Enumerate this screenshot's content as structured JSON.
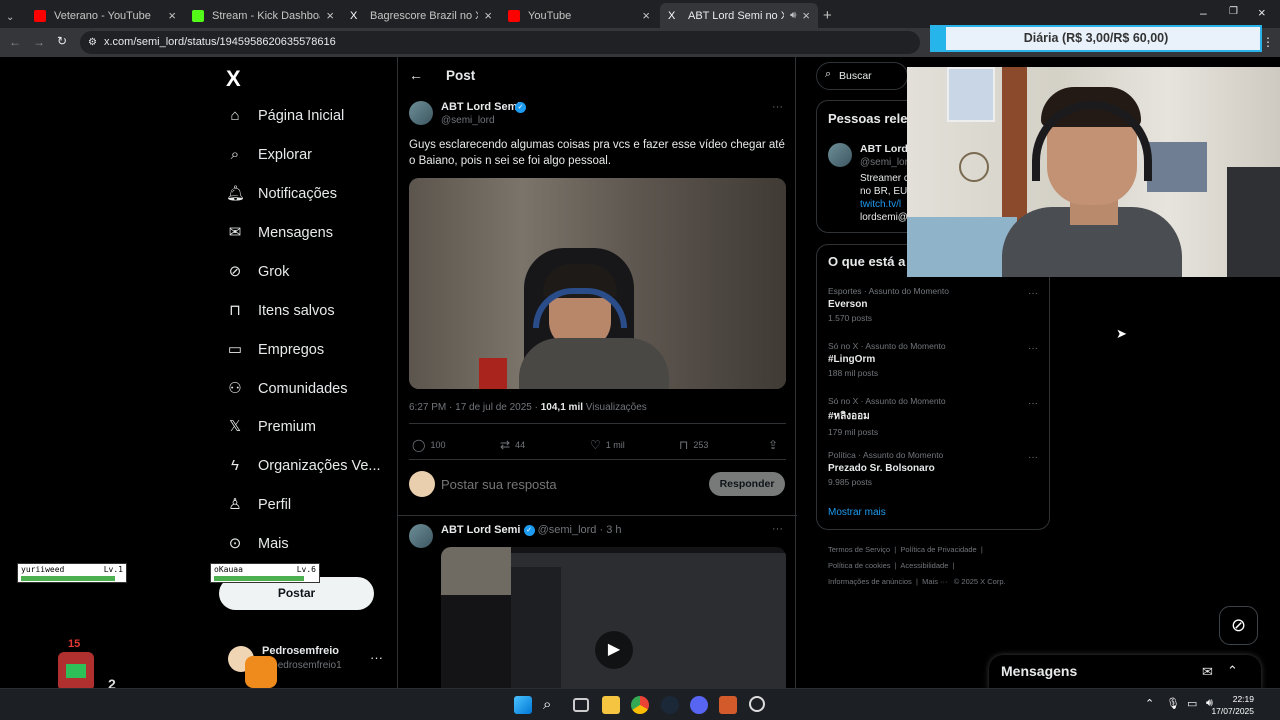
{
  "browser": {
    "tabs": [
      {
        "title": "Veterano - YouTube",
        "active": false
      },
      {
        "title": "Stream - Kick Dashboard",
        "active": false
      },
      {
        "title": "Bagrescore Brazil no X: \"COMO",
        "active": false
      },
      {
        "title": "YouTube",
        "active": false
      },
      {
        "title": "ABT Lord Semi no X: \"Guys",
        "active": true
      }
    ],
    "url": "x.com/semi_lord/status/1945958620635578616",
    "new_tab": "+"
  },
  "overlay": {
    "diaria": "Diária (R$ 3,00/R$ 60,00)",
    "game": {
      "p1_name": "yuriiweed",
      "p1_level": "Lv.1",
      "p1_hp": 0.95,
      "p2_name": "oKauaa",
      "p2_level": "Lv.6",
      "p2_hp": 0.9,
      "score": "15",
      "small_number": "2"
    }
  },
  "x": {
    "logo": "X",
    "nav": [
      {
        "label": "Página Inicial",
        "icon": "home-icon",
        "glyph": "⌂"
      },
      {
        "label": "Explorar",
        "icon": "search-icon",
        "glyph": "⌕"
      },
      {
        "label": "Notificações",
        "icon": "bell-icon",
        "glyph": "🔔︎"
      },
      {
        "label": "Mensagens",
        "icon": "mail-icon",
        "glyph": "✉"
      },
      {
        "label": "Grok",
        "icon": "grok-icon",
        "glyph": "⊘"
      },
      {
        "label": "Itens salvos",
        "icon": "bookmark-icon",
        "glyph": "⊓"
      },
      {
        "label": "Empregos",
        "icon": "briefcase-icon",
        "glyph": "▭"
      },
      {
        "label": "Comunidades",
        "icon": "people-icon",
        "glyph": "⚇"
      },
      {
        "label": "Premium",
        "icon": "x-premium-icon",
        "glyph": "𝕏"
      },
      {
        "label": "Organizações Ve...",
        "icon": "lightning-icon",
        "glyph": "ϟ"
      },
      {
        "label": "Perfil",
        "icon": "person-icon",
        "glyph": "♙"
      },
      {
        "label": "Mais",
        "icon": "more-circle-icon",
        "glyph": "⊙"
      }
    ],
    "post_button": "Postar",
    "account": {
      "name": "Pedrosemfreio",
      "handle": "@pedrosemfreio1"
    },
    "header": {
      "title": "Post"
    },
    "tweet": {
      "author": "ABT Lord Semi",
      "handle": "@semi_lord",
      "text": "Guys esclarecendo algumas coisas pra vcs e fazer esse vídeo chegar até o Baiano, pois n sei se foi algo pessoal.",
      "time": "6:27 PM · 17 de jul de 2025 · ",
      "views_count": "104,1 mil",
      "views_label": "Visualizações",
      "replies": "100",
      "reposts": "44",
      "likes": "1 mil",
      "bookmarks": "253"
    },
    "reply": {
      "placeholder": "Postar sua resposta",
      "button": "Responder"
    },
    "next_tweet": {
      "author": "ABT Lord Semi",
      "handle": "@semi_lord",
      "time": "· 3 h"
    },
    "search": {
      "placeholder": "Buscar"
    },
    "people": {
      "title": "Pessoas rele",
      "name": "ABT Lord S",
      "handle": "@semi_lor",
      "bio1": "Streamer c",
      "bio2": "no BR, EU",
      "link": "twitch.tv/l",
      "email": "lordsemi@"
    },
    "trends": {
      "title": "O que está a",
      "items": [
        {
          "category": "Esportes · Assunto do Momento",
          "name": "Everson",
          "count": "1.570 posts"
        },
        {
          "category": "Só no X · Assunto do Momento",
          "name": "#LingOrm",
          "count": "188 mil posts"
        },
        {
          "category": "Só no X · Assunto do Momento",
          "name": "#หลิงออม",
          "count": "179 mil posts"
        },
        {
          "category": "Política · Assunto do Momento",
          "name": "Prezado Sr. Bolsonaro",
          "count": "9.985 posts"
        }
      ],
      "show_more": "Mostrar mais"
    },
    "footer": {
      "line1": [
        "Termos de Serviço",
        "Política de Privacidade"
      ],
      "line2": [
        "Política de cookies",
        "Acessibilidade"
      ],
      "line3": [
        "Informações de anúncios",
        "Mais ···",
        "© 2025 X Corp."
      ]
    },
    "messages": "Mensagens"
  },
  "taskbar": {
    "time": "22:19",
    "date": "17/07/2025"
  }
}
